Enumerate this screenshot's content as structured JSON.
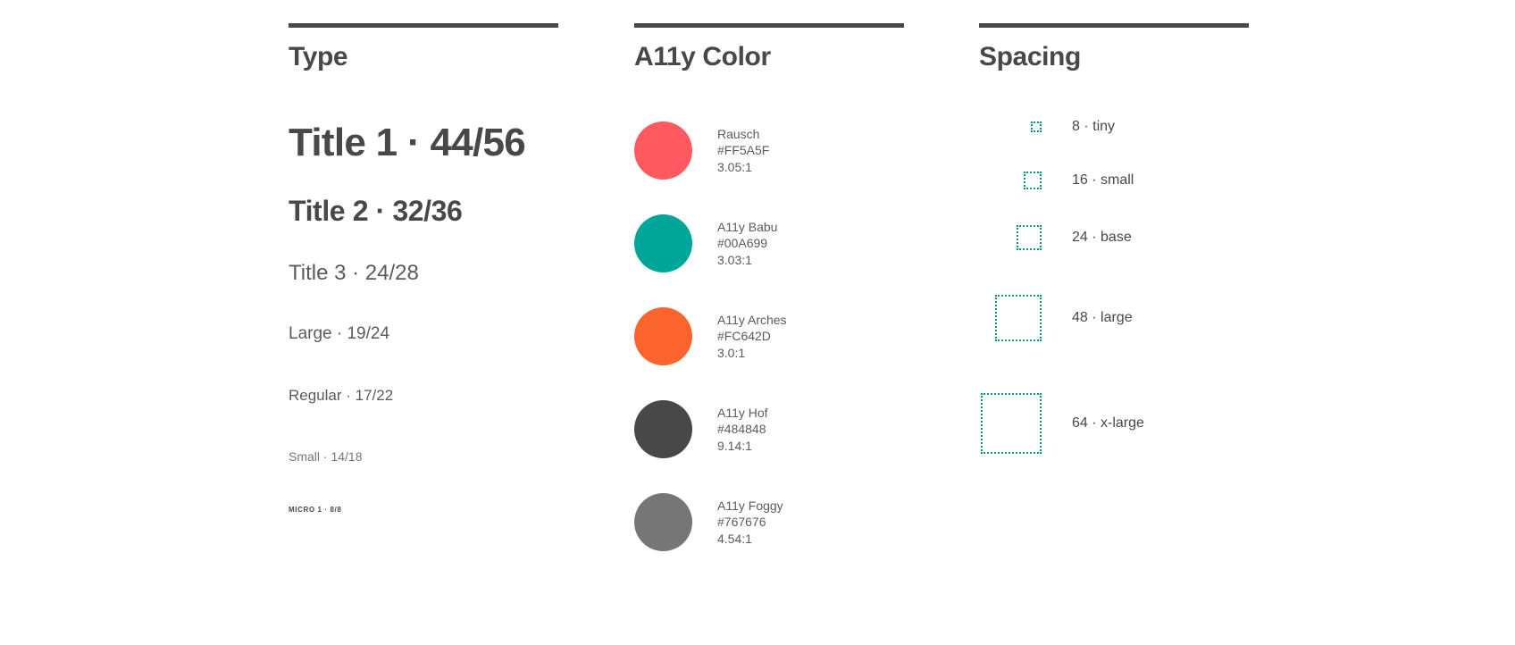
{
  "columns": {
    "type": {
      "title": "Type",
      "specimens": [
        {
          "label": "Title 1 · 44/56"
        },
        {
          "label": "Title 2 · 32/36"
        },
        {
          "label": "Title 3 · 24/28"
        },
        {
          "label": "Large · 19/24"
        },
        {
          "label": "Regular · 17/22"
        },
        {
          "label": "Small · 14/18"
        },
        {
          "label": "MICRO 1 · 8/8"
        }
      ]
    },
    "color": {
      "title": "A11y Color",
      "swatches": [
        {
          "name": "Rausch",
          "hex": "#FF5A5F",
          "contrast": "3.05:1"
        },
        {
          "name": "A11y Babu",
          "hex": "#00A699",
          "contrast": "3.03:1"
        },
        {
          "name": "A11y Arches",
          "hex": "#FC642D",
          "contrast": "3.0:1"
        },
        {
          "name": "A11y Hof",
          "hex": "#484848",
          "contrast": "9.14:1"
        },
        {
          "name": "A11y Foggy",
          "hex": "#767676",
          "contrast": "4.54:1"
        }
      ]
    },
    "spacing": {
      "title": "Spacing",
      "accent": "#009688",
      "tokens": [
        {
          "label": "8 · tiny",
          "size": 8
        },
        {
          "label": "16 · small",
          "size": 16
        },
        {
          "label": "24 · base",
          "size": 24
        },
        {
          "label": "48 · large",
          "size": 48
        },
        {
          "label": "64 · x-large",
          "size": 64
        }
      ]
    }
  }
}
